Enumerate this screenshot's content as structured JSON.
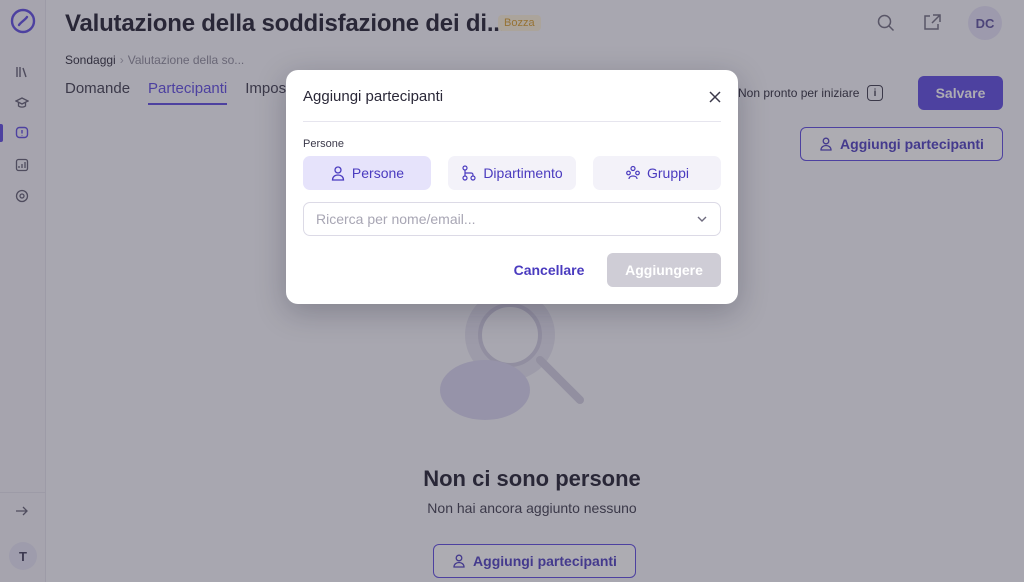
{
  "header": {
    "title": "Valutazione della soddisfazione dei di...",
    "badge": "Bozza",
    "avatar_initials": "DC",
    "search_icon": "search-icon",
    "share_icon": "external-link-icon"
  },
  "breadcrumb": {
    "root": "Sondaggi",
    "current": "Valutazione della so..."
  },
  "tabs": [
    {
      "label": "Domande",
      "active": false
    },
    {
      "label": "Partecipanti",
      "active": true
    },
    {
      "label": "Impos",
      "active": false
    }
  ],
  "status": {
    "text": "Non pronto per iniziare"
  },
  "buttons": {
    "save": "Salvare",
    "add_participants": "Aggiungi partecipanti"
  },
  "empty_state": {
    "title": "Non ci sono persone",
    "subtitle": "Non hai ancora aggiunto nessuno"
  },
  "sidebar": {
    "user_initial": "T",
    "icons": [
      "library-icon",
      "graduation-cap-icon",
      "survey-icon",
      "analytics-icon",
      "settings-icon"
    ],
    "expand_icon": "arrow-right-icon"
  },
  "modal": {
    "title": "Aggiungi partecipanti",
    "section_label": "Persone",
    "segments": [
      {
        "label": "Persone",
        "icon": "person-icon",
        "active": true
      },
      {
        "label": "Dipartimento",
        "icon": "hierarchy-icon",
        "active": false
      },
      {
        "label": "Gruppi",
        "icon": "group-icon",
        "active": false
      }
    ],
    "search_placeholder": "Ricerca per nome/email...",
    "cancel": "Cancellare",
    "add": "Aggiungere"
  },
  "colors": {
    "accent": "#5b47e0",
    "badge_bg": "#fbf1d7",
    "badge_text": "#d89c27"
  }
}
